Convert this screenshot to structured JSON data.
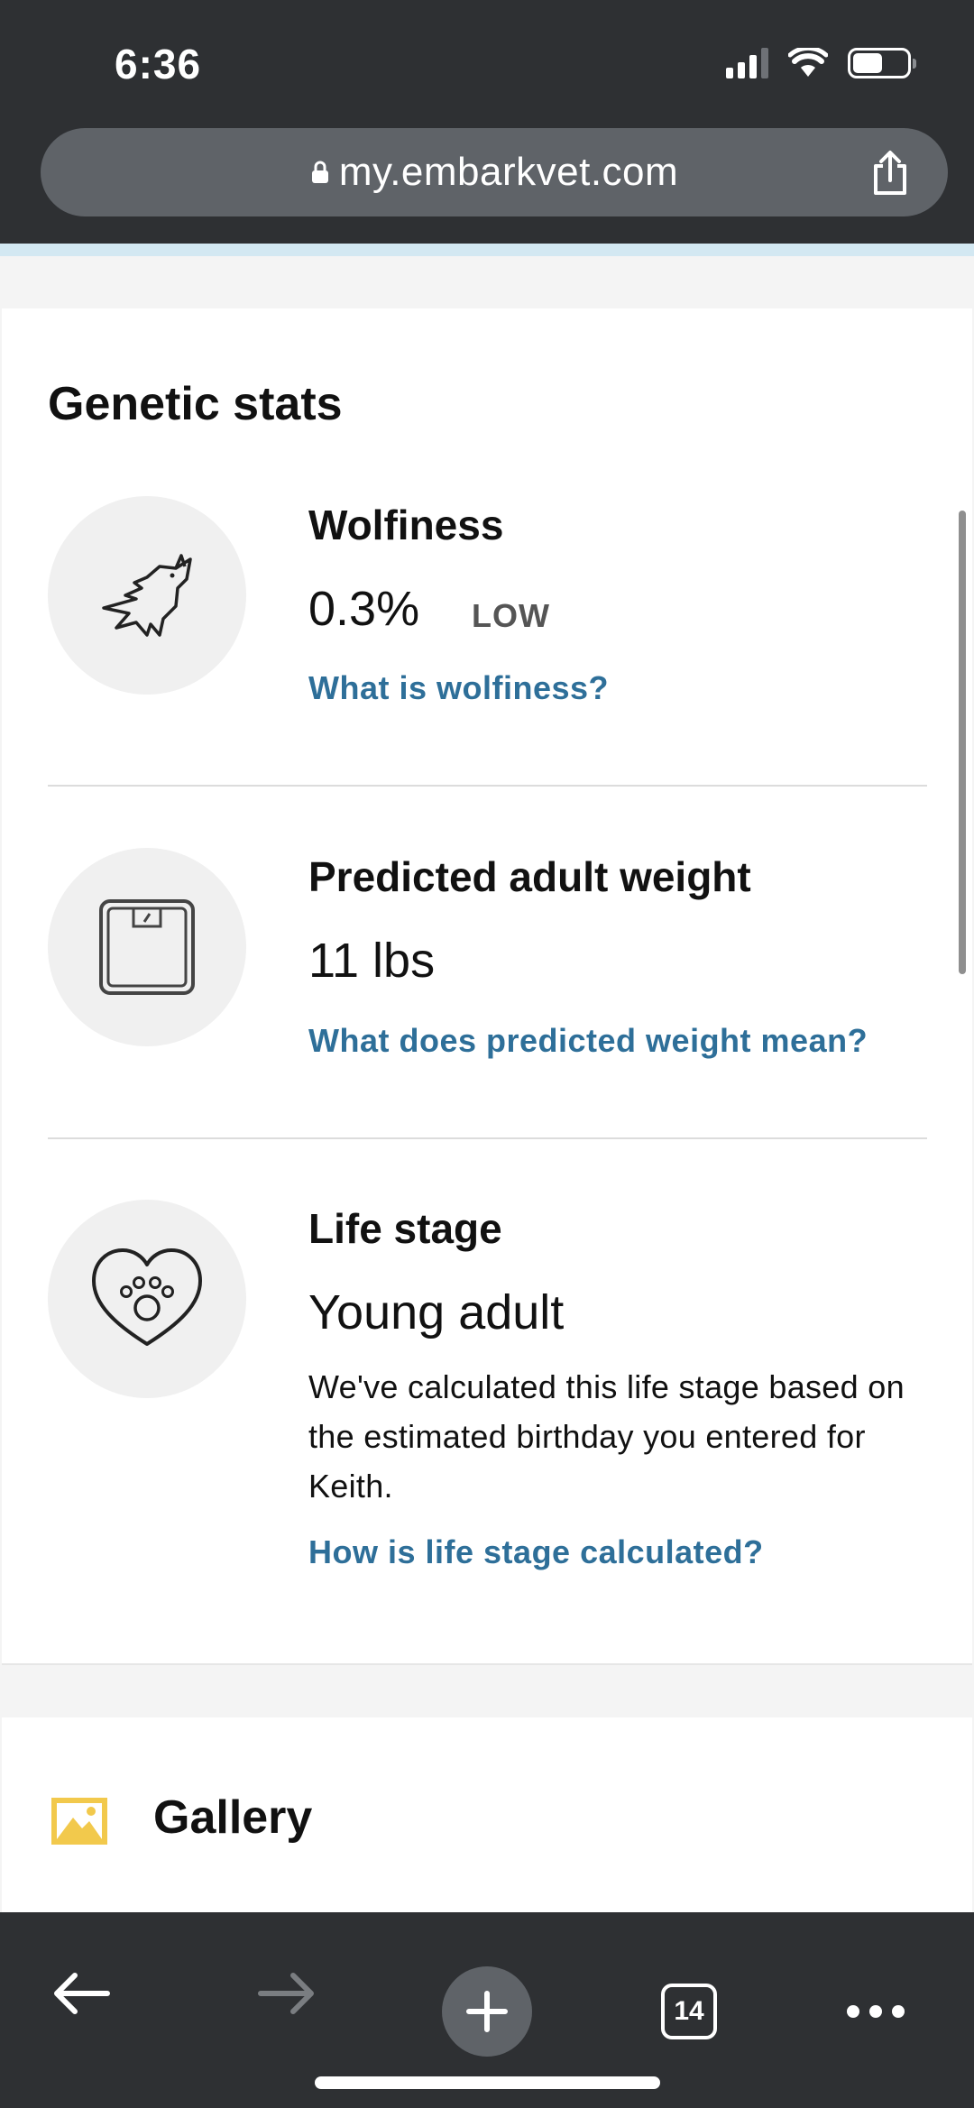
{
  "status_bar": {
    "time": "6:36",
    "battery_level": 0.55
  },
  "browser": {
    "url": "my.embarkvet.com",
    "tab_count": "14",
    "icons": {
      "lock": "lock-icon",
      "share": "share-icon",
      "back": "back-arrow-icon",
      "forward": "forward-arrow-icon",
      "new_tab": "plus-icon",
      "more": "more-icon"
    }
  },
  "genetic_stats": {
    "title": "Genetic stats",
    "wolfiness": {
      "icon": "wolf-icon",
      "title": "Wolfiness",
      "value": "0.3%",
      "badge": "LOW",
      "link": "What is wolfiness?"
    },
    "weight": {
      "icon": "scale-icon",
      "title": "Predicted adult weight",
      "value": "11 lbs",
      "link": "What does predicted weight mean?"
    },
    "life_stage": {
      "icon": "heart-paw-icon",
      "title": "Life stage",
      "value": "Young adult",
      "description": "We've calculated this life stage based on the estimated birthday you entered for Keith.",
      "link": "How is life stage calculated?"
    }
  },
  "gallery": {
    "icon": "image-icon",
    "title": "Gallery"
  },
  "colors": {
    "chrome": "#2e3033",
    "url_bar": "#5f6368",
    "link": "#2e6f99",
    "accent_strip": "#d3e8f2",
    "gallery_icon": "#f2c94c"
  }
}
